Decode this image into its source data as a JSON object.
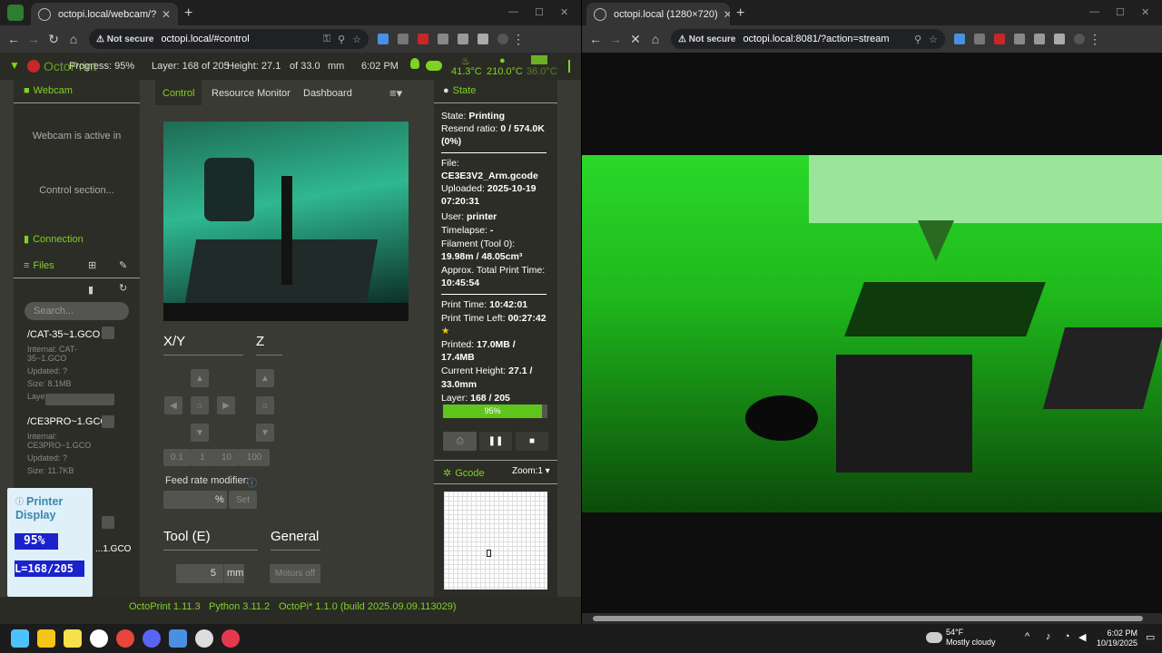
{
  "left_window": {
    "tab_title": "octopi.local/webcam/?action=s",
    "url": "octopi.local/#control",
    "not_secure": "Not secure",
    "navbar": {
      "brand": "OctoPrint",
      "progress": "Progress: 95%",
      "layer": "Layer: 168 of 205",
      "height": "Height: 27.1",
      "height_of": "of 33.0",
      "height_unit": "mm",
      "time": "6:02 PM",
      "temp_bed": "41.3°C",
      "temp_tool": "210.0°C",
      "temp_other": "36.0°C"
    },
    "sidebar": {
      "webcam_title": "Webcam",
      "webcam_msg1": "Webcam is active in",
      "webcam_msg2": "Control section...",
      "connection_title": "Connection",
      "files_title": "Files",
      "search_placeholder": "Search...",
      "files": [
        {
          "name": "/CAT-35~1.GCO",
          "internal": "Internal: CAT-35~1.GCO",
          "updated": "Updated: ?",
          "size": "Size: 8.1MB",
          "layer": "Layer..."
        },
        {
          "name": "/CE3PRO~1.GCO",
          "internal": "Internal: CE3PRO~1.GCO",
          "updated": "Updated: ?",
          "size": "Size: 11.7KB"
        },
        {
          "name": "...1.GCO"
        }
      ]
    },
    "printer_display": {
      "title": "Printer Display",
      "line1": "95%",
      "line2": "L=168/205"
    },
    "tabs": [
      "Control",
      "Resource Monitor",
      "Dashboard"
    ],
    "control": {
      "xy_label": "X/Y",
      "z_label": "Z",
      "steps": [
        "0.1",
        "1",
        "10",
        "100"
      ],
      "feed_label": "Feed rate modifier:",
      "feed_unit": "%",
      "feed_set": "Set",
      "tool_label": "Tool (E)",
      "general_label": "General",
      "tool_amount": "5",
      "tool_unit": "mm",
      "motors_off": "Motors off"
    },
    "state": {
      "title": "State",
      "state_label": "State:",
      "state_value": "Printing",
      "resend_label": "Resend ratio:",
      "resend_value": "0 / 574.0K",
      "resend_pct": "(0%)",
      "file_label": "File:",
      "file_value": "CE3E3V2_Arm.gcode",
      "uploaded_label": "Uploaded:",
      "uploaded_value": "2025-10-19",
      "uploaded_time": "07:20:31",
      "user_label": "User:",
      "user_value": "printer",
      "timelapse_label": "Timelapse:",
      "timelapse_value": "-",
      "filament_label": "Filament (Tool 0):",
      "filament_value": "19.98m / 48.05cm³",
      "approx_label": "Approx. Total Print Time:",
      "approx_value": "10:45:54",
      "printtime_label": "Print Time:",
      "printtime_value": "10:42:01",
      "timeleft_label": "Print Time Left:",
      "timeleft_value": "00:27:42",
      "printed_label": "Printed:",
      "printed_value": "17.0MB /",
      "printed_value2": "17.4MB",
      "curheight_label": "Current Height:",
      "curheight_value": "27.1 /",
      "curheight_value2": "33.0mm",
      "layer_label": "Layer:",
      "layer_value": "168 / 205",
      "progress_text": "95%",
      "progress_fraction": 0.95
    },
    "gcode": {
      "title": "Gcode",
      "zoom": "Zoom:1"
    },
    "footer": {
      "octoprint": "OctoPrint 1.11.3",
      "python": "Python 3.11.2",
      "octopi": "OctoPi* 1.1.0 (build 2025.09.09.113029)"
    }
  },
  "right_window": {
    "tab_title": "octopi.local (1280×720)",
    "url": "octopi.local:8081/?action=stream",
    "not_secure": "Not secure"
  },
  "taskbar": {
    "temperature": "54°F",
    "weather": "Mostly cloudy",
    "time": "6:02 PM",
    "date": "10/19/2025"
  },
  "colors": {
    "accent": "#7ed321",
    "panel": "#2d2d27",
    "navbar": "#2b2b26",
    "progress": "#5fc41c"
  }
}
